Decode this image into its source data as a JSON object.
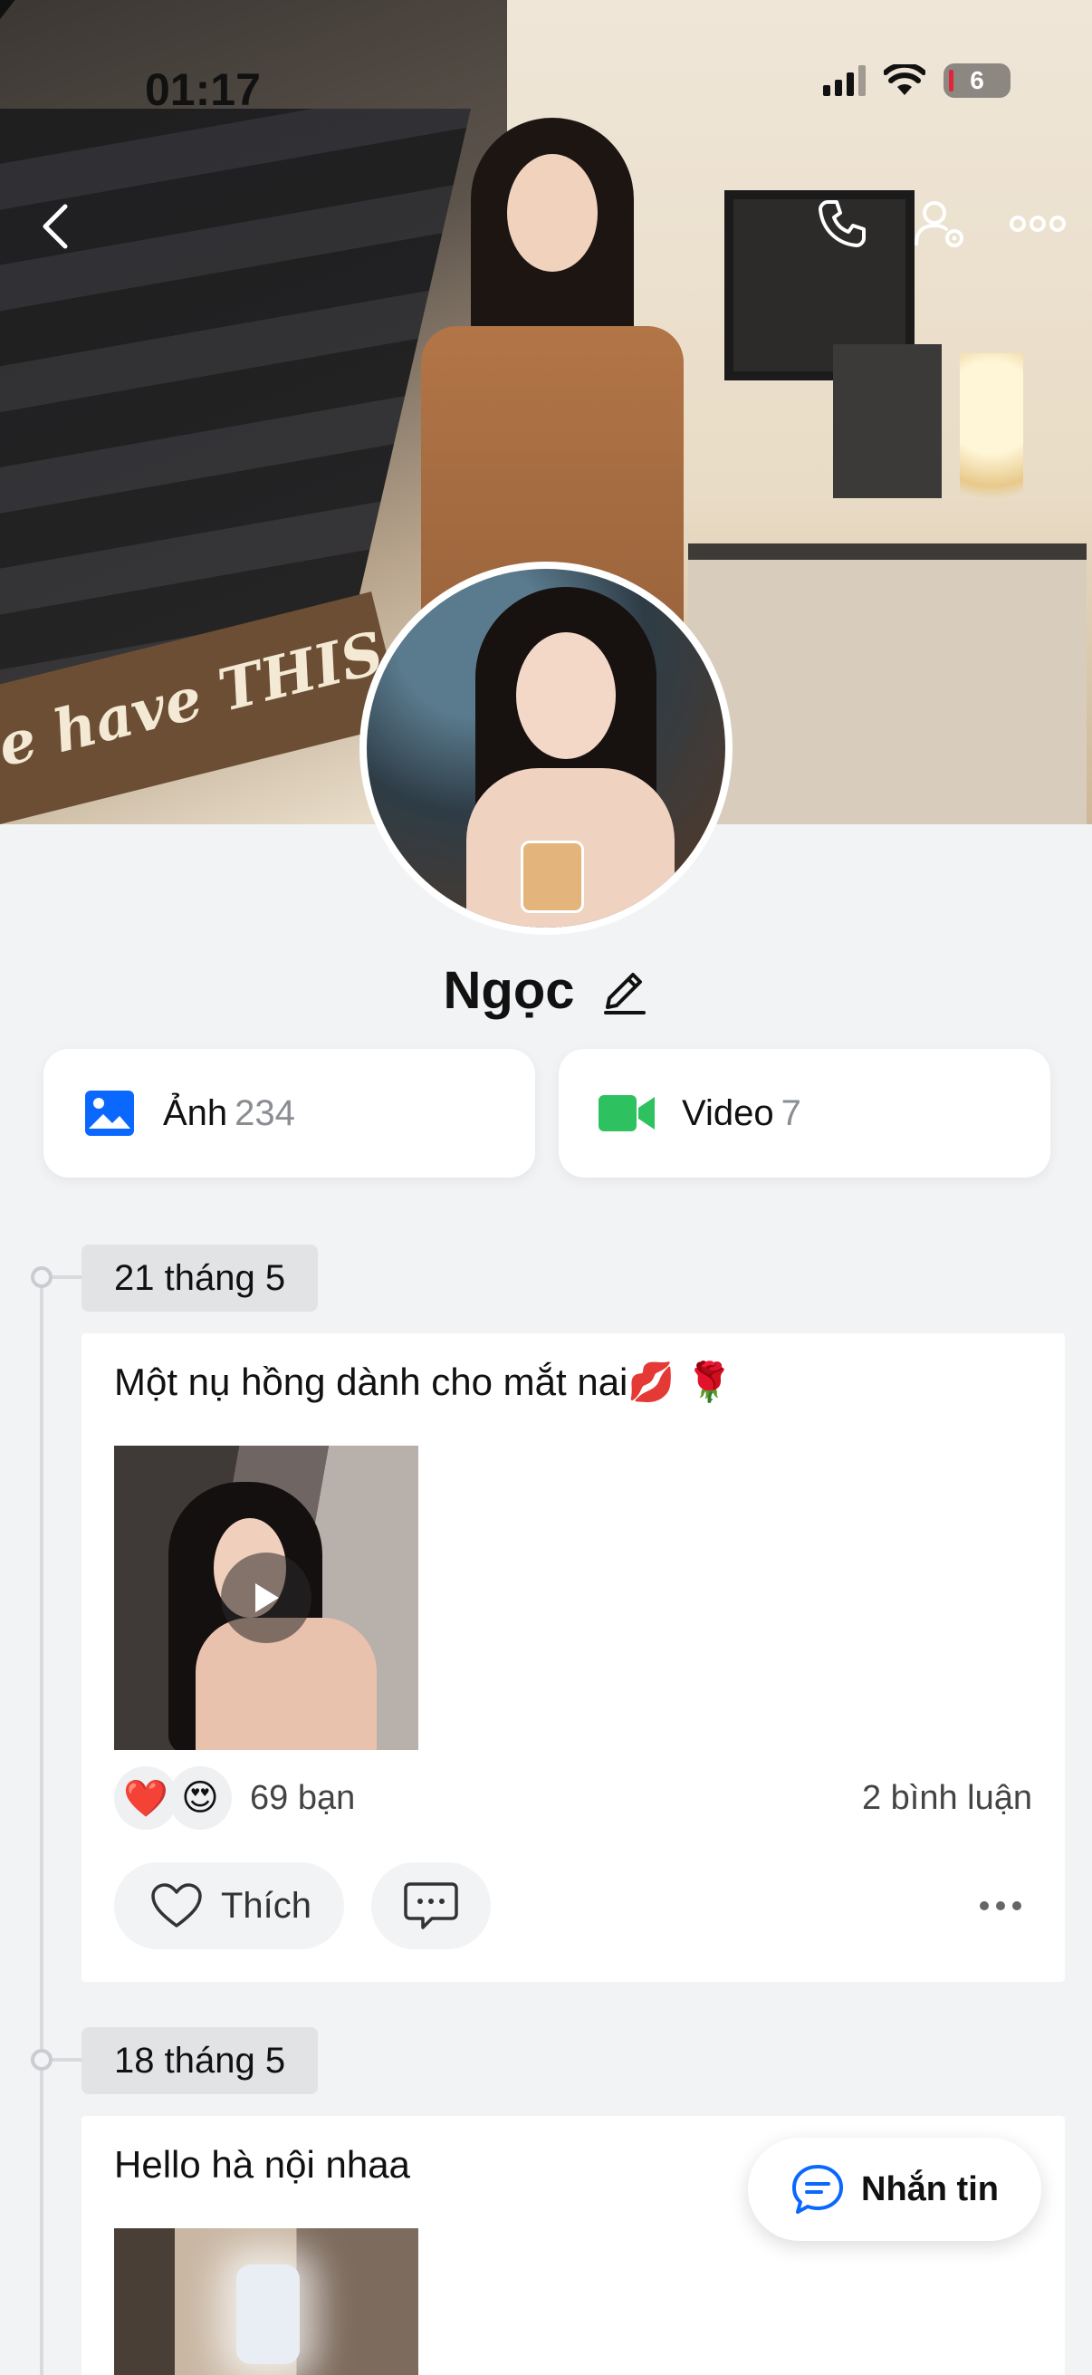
{
  "status_bar": {
    "time": "01:17",
    "battery": "6"
  },
  "cover": {
    "sign_text": "e have THIS"
  },
  "nav": {
    "back_icon": "chevron-left-icon",
    "call_icon": "phone-icon",
    "settings_icon": "user-settings-icon",
    "more_icon": "more-horizontal-icon"
  },
  "profile": {
    "name": "Ngọc"
  },
  "media": [
    {
      "label": "Ảnh",
      "count": "234",
      "icon": "photo-icon",
      "color": "#0a68ff"
    },
    {
      "label": "Video",
      "count": "7",
      "icon": "video-icon",
      "color": "#2dc25f"
    }
  ],
  "posts": [
    {
      "date": "21 tháng 5",
      "text": "Một nụ hồng dành cho mắt nai💋 🌹",
      "media_type": "video",
      "reactions": [
        "❤️",
        "😍"
      ],
      "reaction_count": "69 bạn",
      "comment_count": "2 bình luận",
      "like_label": "Thích"
    },
    {
      "date": "18 tháng 5",
      "text": "Hello hà nội nhaa",
      "media_type": "photo"
    }
  ],
  "fab": {
    "label": "Nhắn tin"
  },
  "colors": {
    "accent": "#0a68ff",
    "video": "#2dc25f",
    "background": "#f2f3f5"
  }
}
